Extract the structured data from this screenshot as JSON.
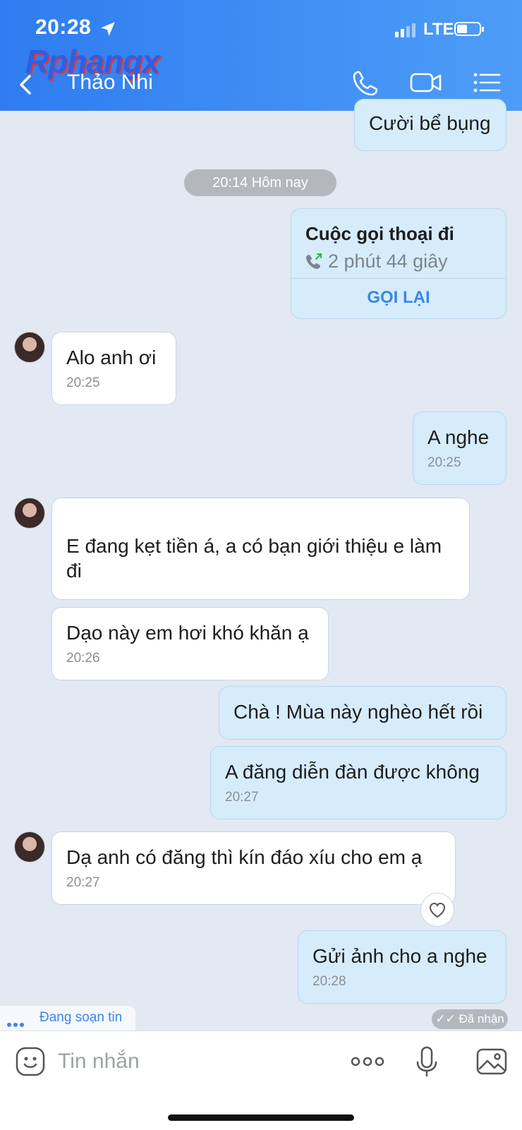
{
  "status": {
    "time": "20:28",
    "network": "LTE",
    "battery_level": 0.45
  },
  "watermark": "Rphangx",
  "header": {
    "title": "Thảo Nhi",
    "icons": [
      "back-chevron-icon",
      "phone-icon",
      "video-call-icon",
      "menu-list-icon"
    ]
  },
  "messages": {
    "m0": {
      "text": "Cười bể bụng"
    },
    "date": "20:14 Hôm nay",
    "call": {
      "title": "Cuộc gọi thoại đi",
      "duration": "2 phút 44 giây",
      "action": "GỌI LẠI"
    },
    "m1": {
      "text": "Alo anh ơi",
      "time": "20:25"
    },
    "m2": {
      "text": "A nghe",
      "time": "20:25"
    },
    "m3": {
      "text": "E đang kẹt tiền á, a có bạn giới thiệu e làm đi"
    },
    "m4": {
      "text": "Dạo này em hơi khó khăn ạ",
      "time": "20:26"
    },
    "m5": {
      "text": "Chà ! Mùa này nghèo hết rồi"
    },
    "m6": {
      "text": "A đăng diễn đàn được không",
      "time": "20:27"
    },
    "m7": {
      "text": "Dạ anh có đăng thì kín đáo xíu cho em ạ",
      "time": "20:27"
    },
    "m8": {
      "text": "Gửi ảnh cho a nghe",
      "time": "20:28"
    }
  },
  "typing": "Đang soạn tin",
  "received": "Đã nhận",
  "composer": {
    "placeholder": "Tin nhắn",
    "icons": [
      "emoji-icon",
      "more-options-icon",
      "microphone-icon",
      "image-icon"
    ]
  },
  "colors": {
    "header": "#2f7cf0",
    "outgoing": "#d6ecfb",
    "incoming": "#ffffff",
    "background": "#e2e9f2",
    "accent": "#3a86e8"
  }
}
